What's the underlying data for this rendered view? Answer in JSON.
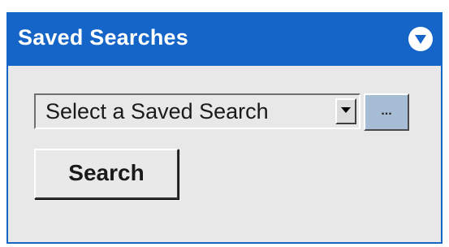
{
  "panel": {
    "title": "Saved Searches",
    "collapse_icon": "chevron-down-circle-icon",
    "colors": {
      "header_bg": "#1565c9",
      "body_bg": "#e8e8e8",
      "more_button_bg": "#a7bdd6"
    }
  },
  "saved_search_select": {
    "selected": "Select a Saved Search",
    "arrow_icon": "triangle-down-icon"
  },
  "more_button": {
    "label": "..."
  },
  "search_button": {
    "label": "Search"
  }
}
